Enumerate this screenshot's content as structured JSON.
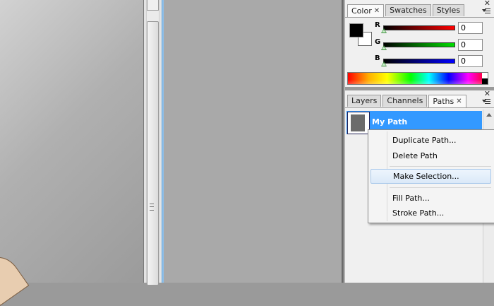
{
  "color_panel": {
    "tabs": [
      {
        "label": "Color",
        "closable": true
      },
      {
        "label": "Swatches",
        "closable": false
      },
      {
        "label": "Styles",
        "closable": false
      }
    ],
    "channels": [
      {
        "label": "R",
        "value": "0",
        "color": "#ff0000"
      },
      {
        "label": "G",
        "value": "0",
        "color": "#00cc00"
      },
      {
        "label": "B",
        "value": "0",
        "color": "#0000ff"
      }
    ],
    "foreground_color": "#000000",
    "background_color": "#ffffff"
  },
  "paths_panel": {
    "tabs": [
      {
        "label": "Layers",
        "closable": false
      },
      {
        "label": "Channels",
        "closable": false
      },
      {
        "label": "Paths",
        "closable": true
      }
    ],
    "path_name": "My Path",
    "selected_color": "#3399ff"
  },
  "context_menu": {
    "items": [
      {
        "label": "Duplicate Path..."
      },
      {
        "label": "Delete Path"
      },
      {
        "label": "Make Selection...",
        "highlighted": true
      },
      {
        "label": "Fill Path..."
      },
      {
        "label": "Stroke Path..."
      }
    ]
  },
  "glyphs": {
    "close": "✕",
    "grip": "≡"
  }
}
